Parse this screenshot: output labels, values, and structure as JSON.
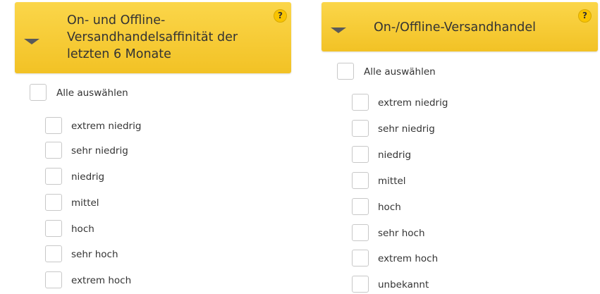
{
  "left_panel": {
    "title_lines": [
      "On- und Offline-",
      "Versandhandelsaffinität der",
      "letzten 6 Monate"
    ],
    "help_icon": "?",
    "select_all": "Alle auswählen",
    "options": [
      "extrem niedrig",
      "sehr niedrig",
      "niedrig",
      "mittel",
      "hoch",
      "sehr hoch",
      "extrem hoch"
    ]
  },
  "right_panel": {
    "title": "On-/Offline-Versandhandel",
    "help_icon": "?",
    "select_all": "Alle auswählen",
    "options": [
      "extrem niedrig",
      "sehr niedrig",
      "niedrig",
      "mittel",
      "hoch",
      "sehr hoch",
      "extrem hoch",
      "unbekannt"
    ]
  },
  "colors": {
    "header_top": "#fbd64a",
    "header_bottom": "#f2c225",
    "help_badge": "#f9c400"
  }
}
